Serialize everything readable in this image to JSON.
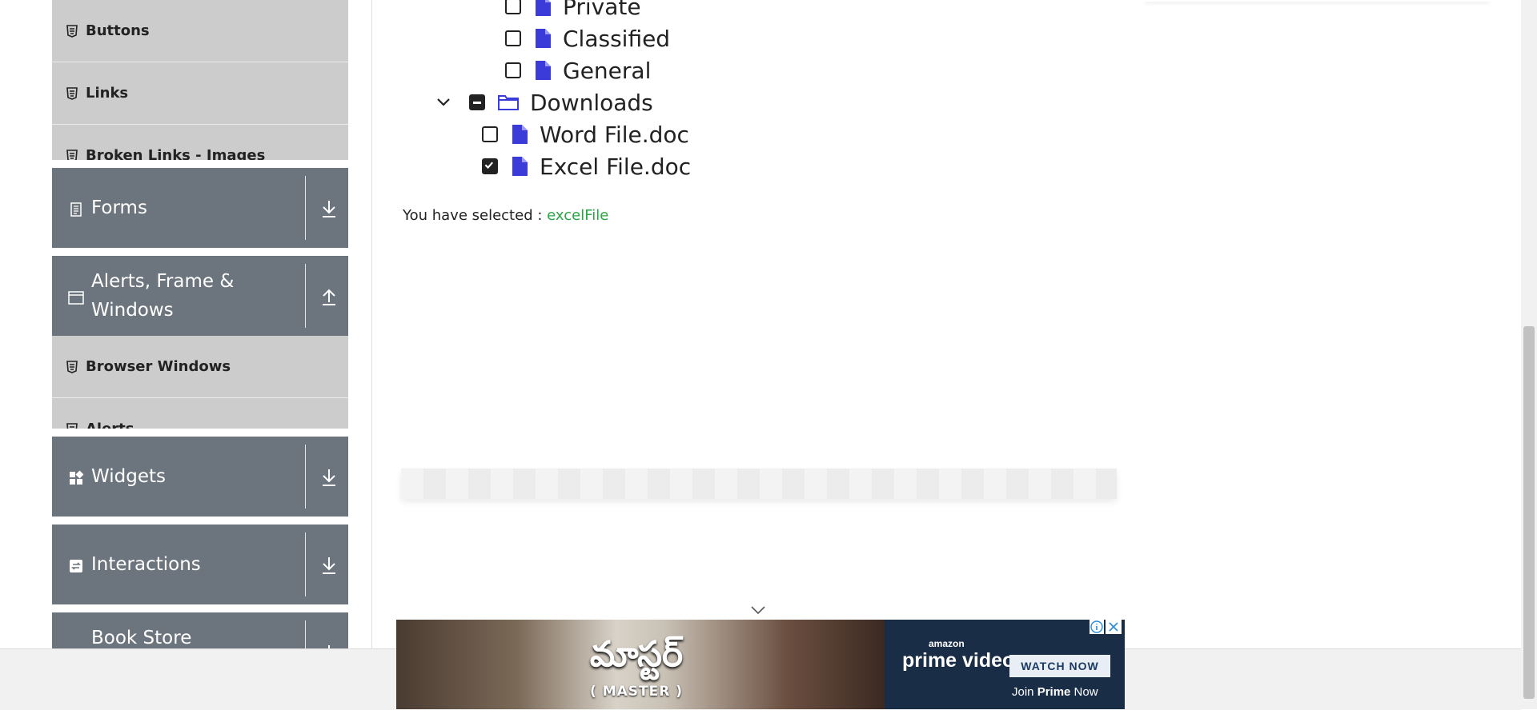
{
  "sidebar": {
    "elements_items": [
      {
        "label": "Buttons"
      },
      {
        "label": "Links"
      },
      {
        "label": "Broken Links - Images"
      }
    ],
    "forms": {
      "label": "Forms",
      "icon": "document-icon",
      "arrow": "expand-down"
    },
    "alerts": {
      "label": "Alerts, Frame & Windows",
      "icon": "window-icon",
      "arrow": "collapse-up"
    },
    "alerts_items": [
      {
        "label": "Browser Windows"
      },
      {
        "label": "Alerts"
      }
    ],
    "widgets": {
      "label": "Widgets",
      "icon": "widgets-icon",
      "arrow": "expand-down"
    },
    "interactions": {
      "label": "Interactions",
      "icon": "interactions-icon",
      "arrow": "expand-down"
    },
    "bookstore": {
      "label": "Book Store Application",
      "icon": "book-icon",
      "arrow": "expand-down"
    }
  },
  "tree": {
    "private": "Private",
    "classified": "Classified",
    "general": "General",
    "downloads": "Downloads",
    "word": "Word File.doc",
    "excel": "Excel File.doc"
  },
  "result": {
    "prefix": "You have selected :",
    "value": "excelFile"
  },
  "ad": {
    "title": "మాస్టర్",
    "subtitle": "( MASTER )",
    "brand_small": "amazon",
    "brand": "prime video",
    "cta": "WATCH NOW",
    "join_prefix": "Join ",
    "join_bold": "Prime",
    "join_suffix": " Now",
    "colors": {
      "prime_bg": "#1a2d47",
      "accent_green": "#28a745",
      "sidebar_dark": "#6c757d"
    }
  }
}
